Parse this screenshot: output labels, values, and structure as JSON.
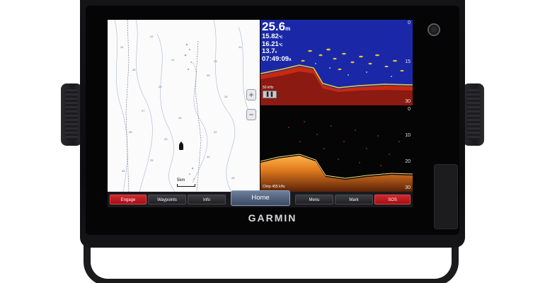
{
  "device": {
    "brand": "GARMIN",
    "colors": {
      "bezel": "#0d0d0f",
      "engage": "#c41b21",
      "sos": "#c41b21",
      "home": "#52637f",
      "sonar_top_bg": "#1a28a8"
    }
  },
  "sonar": {
    "depth_value": "25.6",
    "depth_unit": "m",
    "line1_value": "15.82",
    "line1_unit": "℃",
    "line2_value": "16.21",
    "line2_unit": "℃",
    "line3_value": "13.7",
    "line3_unit": "v",
    "time_value": "07:49:09",
    "time_unit": "A",
    "top_scale": [
      "0",
      "15",
      "30"
    ],
    "bottom_scale": [
      "0",
      "10",
      "20",
      "30"
    ],
    "top_freq_label": "50 kHz",
    "pause_icon": "pause-icon",
    "bottom_freq_label": "Chirp 455 kHz"
  },
  "chart": {
    "zoom_in_label": "+",
    "zoom_out_label": "−",
    "scale_label": "5km"
  },
  "softkeys": {
    "engage": "Engage",
    "waypoints": "Waypoints",
    "info": "Info",
    "home": "Home",
    "menu": "Menu",
    "mark": "Mark",
    "sos": "SOS"
  }
}
